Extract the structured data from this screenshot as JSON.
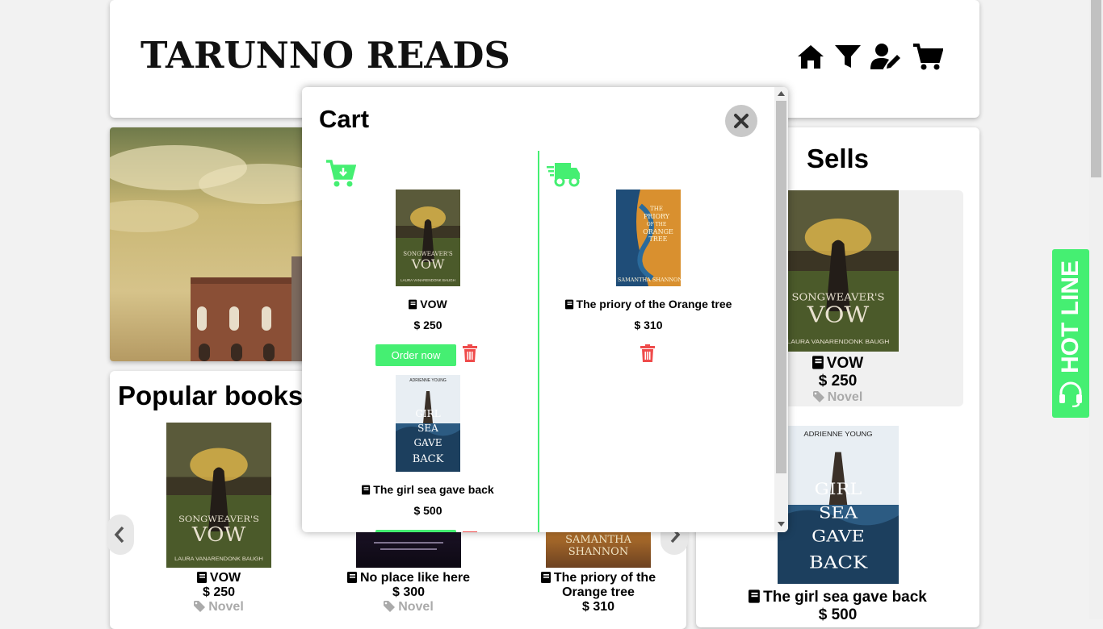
{
  "header": {
    "brand": "TARUNNO READS",
    "nav": [
      "home-icon",
      "filter-icon",
      "user-edit-icon",
      "cart-icon"
    ]
  },
  "popular": {
    "title": "Popular books",
    "books": [
      {
        "title": "VOW",
        "price": "$ 250",
        "genre": "Novel"
      },
      {
        "title": "No place like here",
        "price": "$ 300",
        "genre": "Novel"
      },
      {
        "title": "The priory of the Orange tree",
        "price": "$ 310",
        "genre": ""
      }
    ]
  },
  "sells": {
    "title": "Sells",
    "books": [
      {
        "title": "VOW",
        "price": "$ 250",
        "genre": "Novel"
      },
      {
        "title": "The girl sea gave back",
        "price": "$ 500"
      }
    ]
  },
  "hotline": {
    "label": "HOT LINE"
  },
  "modal": {
    "title": "Cart",
    "cart_items": [
      {
        "title": "VOW",
        "price": "$ 250",
        "action": "Order now"
      },
      {
        "title": "The girl sea gave back",
        "price": "$ 500"
      }
    ],
    "ordered_items": [
      {
        "title": "The priory of the Orange tree",
        "price": "$ 310"
      }
    ]
  },
  "covers": {
    "vow": {
      "line1": "THE",
      "line2": "SONGWEAVER'S",
      "line3": "VOW",
      "author": "LAURA VANARENDONK BAUGH"
    },
    "girl": {
      "author": "ADRIENNE YOUNG",
      "line1": "THE",
      "line2": "GIRL",
      "line3": "THE",
      "line4": "SEA",
      "line5": "GAVE",
      "line6": "BACK"
    },
    "priory": {
      "line1": "THE",
      "line2": "PRIORY",
      "line3": "OF THE",
      "line4": "ORANGE",
      "line5": "TREE",
      "author": "SAMANTHA SHANNON"
    }
  },
  "colors": {
    "accent": "#45ef72",
    "danger": "#ef4b4b"
  }
}
